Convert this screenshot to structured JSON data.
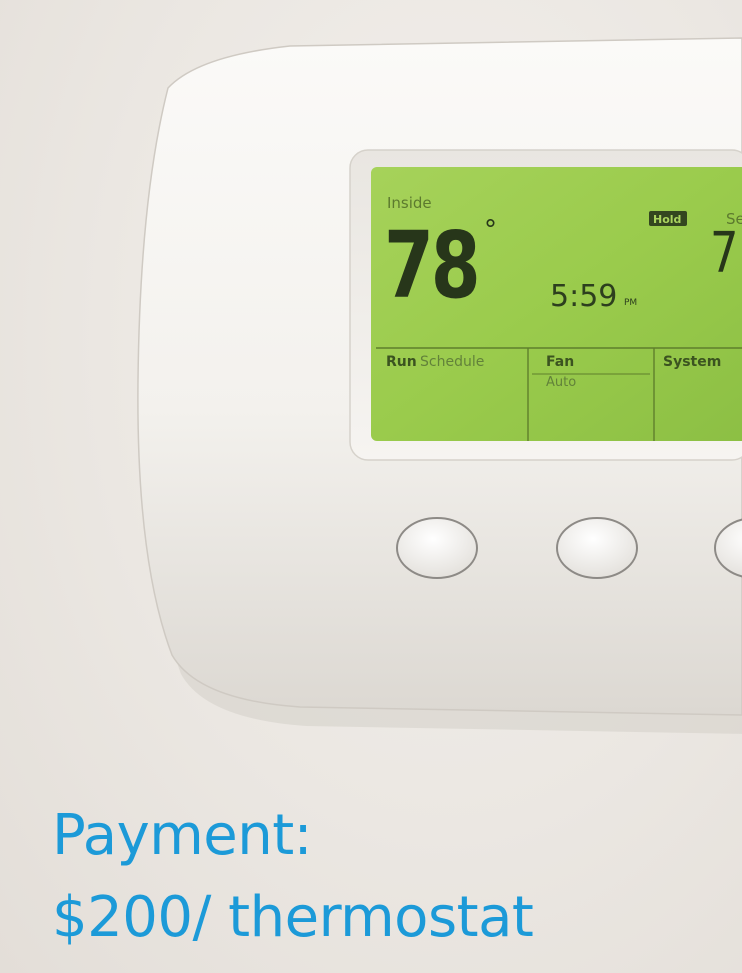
{
  "thermostat": {
    "inside_label": "Inside",
    "inside_temp": "78",
    "degree": "°",
    "hold_badge": "Hold",
    "set_label_partial": "Se",
    "set_temp_partial": "7",
    "time": "5:59",
    "time_suffix": "PM",
    "run_label": "Run",
    "schedule_label": "Schedule",
    "fan_label": "Fan",
    "fan_value": "Auto",
    "system_label": "System"
  },
  "caption": {
    "line1": "Payment:",
    "line2": "$200/ thermostat"
  },
  "colors": {
    "caption": "#1c9ad8",
    "lcd": "#98c84a",
    "wall": "#ece8e3",
    "housing": "#f7f6f3"
  }
}
